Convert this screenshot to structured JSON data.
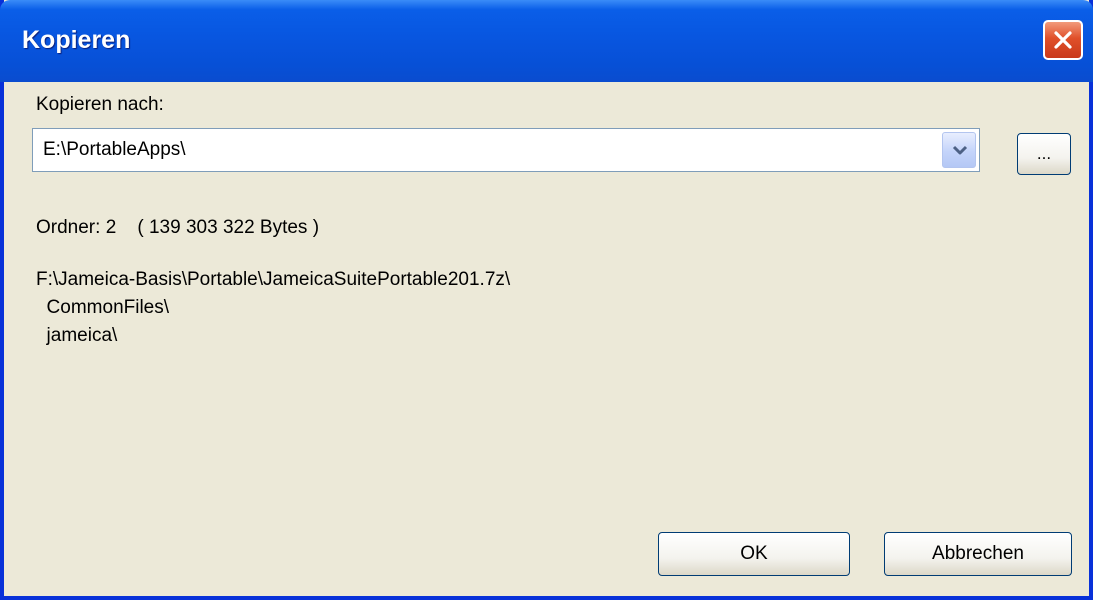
{
  "window": {
    "title": "Kopieren"
  },
  "dialog": {
    "destination_label": "Kopieren nach:",
    "destination_value": "E:\\PortableApps\\",
    "browse_label": "...",
    "summary": "Ordner: 2    ( 139 303 322 Bytes )",
    "source_path": "F:\\Jameica-Basis\\Portable\\JameicaSuitePortable201.7z\\",
    "source_items": [
      "  CommonFiles\\",
      "  jameica\\"
    ],
    "ok_label": "OK",
    "cancel_label": "Abbrechen"
  },
  "colors": {
    "titlebar": "#0856e0",
    "frame": "#0831d9",
    "dialog_bg": "#ece9d8",
    "close_button": "#e0502a"
  },
  "icons": {
    "close": "close-icon",
    "dropdown": "chevron-down-icon"
  }
}
